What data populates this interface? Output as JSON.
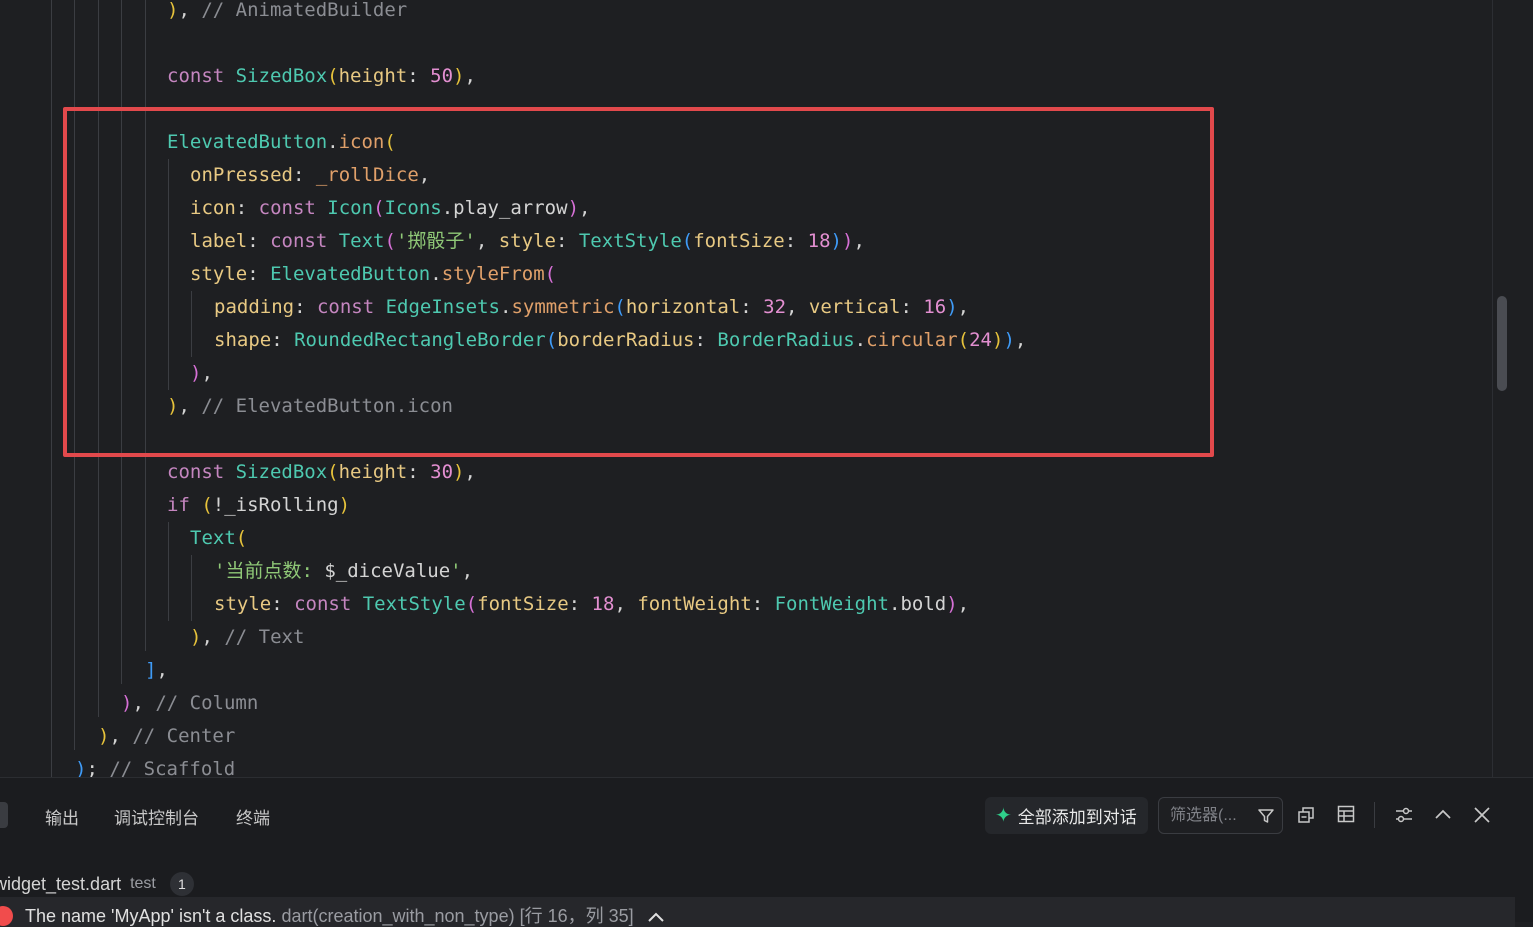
{
  "code_lines": [
    {
      "segs": [
        {
          "t": ")",
          "c": "b1"
        },
        {
          "t": ", ",
          "c": "w"
        },
        {
          "t": "// AnimatedBuilder",
          "c": "c"
        }
      ]
    },
    {
      "segs": []
    },
    {
      "segs": [
        {
          "t": "const ",
          "c": "k"
        },
        {
          "t": "SizedBox",
          "c": "t"
        },
        {
          "t": "(",
          "c": "b1"
        },
        {
          "t": "height",
          "c": "p"
        },
        {
          "t": ": ",
          "c": "w"
        },
        {
          "t": "50",
          "c": "n"
        },
        {
          "t": ")",
          "c": "b1"
        },
        {
          "t": ",",
          "c": "w"
        }
      ]
    },
    {
      "segs": []
    },
    {
      "segs": [
        {
          "t": "ElevatedButton",
          "c": "t"
        },
        {
          "t": ".",
          "c": "w"
        },
        {
          "t": "icon",
          "c": "f"
        },
        {
          "t": "(",
          "c": "b1"
        }
      ]
    },
    {
      "segs": [
        {
          "t": "onPressed",
          "c": "p"
        },
        {
          "t": ": ",
          "c": "w"
        },
        {
          "t": "_rollDice",
          "c": "f"
        },
        {
          "t": ",",
          "c": "w"
        }
      ]
    },
    {
      "segs": [
        {
          "t": "icon",
          "c": "p"
        },
        {
          "t": ": ",
          "c": "w"
        },
        {
          "t": "const ",
          "c": "k"
        },
        {
          "t": "Icon",
          "c": "t"
        },
        {
          "t": "(",
          "c": "b2"
        },
        {
          "t": "Icons",
          "c": "t"
        },
        {
          "t": ".play_arrow",
          "c": "w"
        },
        {
          "t": ")",
          "c": "b2"
        },
        {
          "t": ",",
          "c": "w"
        }
      ]
    },
    {
      "segs": [
        {
          "t": "label",
          "c": "p"
        },
        {
          "t": ": ",
          "c": "w"
        },
        {
          "t": "const ",
          "c": "k"
        },
        {
          "t": "Text",
          "c": "t"
        },
        {
          "t": "(",
          "c": "b2"
        },
        {
          "t": "'掷骰子'",
          "c": "s"
        },
        {
          "t": ", ",
          "c": "w"
        },
        {
          "t": "style",
          "c": "p"
        },
        {
          "t": ": ",
          "c": "w"
        },
        {
          "t": "TextStyle",
          "c": "t"
        },
        {
          "t": "(",
          "c": "b3"
        },
        {
          "t": "fontSize",
          "c": "p"
        },
        {
          "t": ": ",
          "c": "w"
        },
        {
          "t": "18",
          "c": "n"
        },
        {
          "t": ")",
          "c": "b3"
        },
        {
          "t": ")",
          "c": "b2"
        },
        {
          "t": ",",
          "c": "w"
        }
      ]
    },
    {
      "segs": [
        {
          "t": "style",
          "c": "p"
        },
        {
          "t": ": ",
          "c": "w"
        },
        {
          "t": "ElevatedButton",
          "c": "t"
        },
        {
          "t": ".",
          "c": "w"
        },
        {
          "t": "styleFrom",
          "c": "f"
        },
        {
          "t": "(",
          "c": "b2"
        }
      ]
    },
    {
      "segs": [
        {
          "t": "padding",
          "c": "p"
        },
        {
          "t": ": ",
          "c": "w"
        },
        {
          "t": "const ",
          "c": "k"
        },
        {
          "t": "EdgeInsets",
          "c": "t"
        },
        {
          "t": ".",
          "c": "w"
        },
        {
          "t": "symmetric",
          "c": "f"
        },
        {
          "t": "(",
          "c": "b3"
        },
        {
          "t": "horizontal",
          "c": "p"
        },
        {
          "t": ": ",
          "c": "w"
        },
        {
          "t": "32",
          "c": "n"
        },
        {
          "t": ", ",
          "c": "w"
        },
        {
          "t": "vertical",
          "c": "p"
        },
        {
          "t": ": ",
          "c": "w"
        },
        {
          "t": "16",
          "c": "n"
        },
        {
          "t": ")",
          "c": "b3"
        },
        {
          "t": ",",
          "c": "w"
        }
      ]
    },
    {
      "segs": [
        {
          "t": "shape",
          "c": "p"
        },
        {
          "t": ": ",
          "c": "w"
        },
        {
          "t": "RoundedRectangleBorder",
          "c": "t"
        },
        {
          "t": "(",
          "c": "b3"
        },
        {
          "t": "borderRadius",
          "c": "p"
        },
        {
          "t": ": ",
          "c": "w"
        },
        {
          "t": "BorderRadius",
          "c": "t"
        },
        {
          "t": ".",
          "c": "w"
        },
        {
          "t": "circular",
          "c": "f"
        },
        {
          "t": "(",
          "c": "b1"
        },
        {
          "t": "24",
          "c": "n"
        },
        {
          "t": ")",
          "c": "b1"
        },
        {
          "t": ")",
          "c": "b3"
        },
        {
          "t": ",",
          "c": "w"
        }
      ]
    },
    {
      "segs": [
        {
          "t": ")",
          "c": "b2"
        },
        {
          "t": ",",
          "c": "w"
        }
      ]
    },
    {
      "segs": [
        {
          "t": ")",
          "c": "b1"
        },
        {
          "t": ", ",
          "c": "w"
        },
        {
          "t": "// ElevatedButton.icon",
          "c": "c"
        }
      ]
    },
    {
      "segs": []
    },
    {
      "segs": [
        {
          "t": "const ",
          "c": "k"
        },
        {
          "t": "SizedBox",
          "c": "t"
        },
        {
          "t": "(",
          "c": "b1"
        },
        {
          "t": "height",
          "c": "p"
        },
        {
          "t": ": ",
          "c": "w"
        },
        {
          "t": "30",
          "c": "n"
        },
        {
          "t": ")",
          "c": "b1"
        },
        {
          "t": ",",
          "c": "w"
        }
      ]
    },
    {
      "segs": [
        {
          "t": "if ",
          "c": "k"
        },
        {
          "t": "(",
          "c": "b1"
        },
        {
          "t": "!_isRolling",
          "c": "w"
        },
        {
          "t": ")",
          "c": "b1"
        }
      ]
    },
    {
      "segs": [
        {
          "t": "Text",
          "c": "t"
        },
        {
          "t": "(",
          "c": "b1"
        }
      ]
    },
    {
      "segs": [
        {
          "t": "'当前点数: ",
          "c": "s"
        },
        {
          "t": "$_diceValue",
          "c": "w"
        },
        {
          "t": "'",
          "c": "s"
        },
        {
          "t": ",",
          "c": "w"
        }
      ]
    },
    {
      "segs": [
        {
          "t": "style",
          "c": "p"
        },
        {
          "t": ": ",
          "c": "w"
        },
        {
          "t": "const ",
          "c": "k"
        },
        {
          "t": "TextStyle",
          "c": "t"
        },
        {
          "t": "(",
          "c": "b2"
        },
        {
          "t": "fontSize",
          "c": "p"
        },
        {
          "t": ": ",
          "c": "w"
        },
        {
          "t": "18",
          "c": "n"
        },
        {
          "t": ", ",
          "c": "w"
        },
        {
          "t": "fontWeight",
          "c": "p"
        },
        {
          "t": ": ",
          "c": "w"
        },
        {
          "t": "FontWeight",
          "c": "t"
        },
        {
          "t": ".bold",
          "c": "w"
        },
        {
          "t": ")",
          "c": "b2"
        },
        {
          "t": ",",
          "c": "w"
        }
      ]
    },
    {
      "segs": [
        {
          "t": ")",
          "c": "b1"
        },
        {
          "t": ", ",
          "c": "w"
        },
        {
          "t": "// Text",
          "c": "c"
        }
      ]
    },
    {
      "segs": [
        {
          "t": "]",
          "c": "b3"
        },
        {
          "t": ",",
          "c": "w"
        }
      ]
    },
    {
      "segs": [
        {
          "t": ")",
          "c": "b2"
        },
        {
          "t": ", ",
          "c": "w"
        },
        {
          "t": "// Column",
          "c": "c"
        }
      ]
    },
    {
      "segs": [
        {
          "t": ")",
          "c": "b1"
        },
        {
          "t": ", ",
          "c": "w"
        },
        {
          "t": "// Center",
          "c": "c"
        }
      ]
    },
    {
      "segs": [
        {
          "t": ")",
          "c": "b3"
        },
        {
          "t": "; ",
          "c": "w"
        },
        {
          "t": "// Scaffold",
          "c": "c"
        }
      ]
    }
  ],
  "panel": {
    "tabs": [
      {
        "label": "输出"
      },
      {
        "label": "调试控制台"
      },
      {
        "label": "终端"
      }
    ],
    "add_all_label": "全部添加到对话",
    "filter_placeholder": "筛选器(..."
  },
  "problems": {
    "file_name": "widget_test.dart",
    "file_dir": "test",
    "count": "1",
    "message": "The name 'MyApp' isn't a class.",
    "source": "dart(creation_with_non_type)",
    "location": "[行 16，列 35]"
  }
}
